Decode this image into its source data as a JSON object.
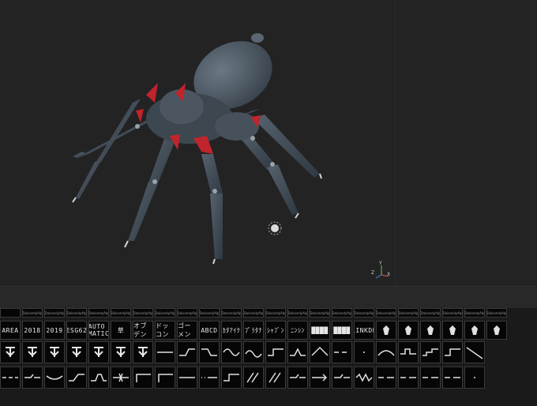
{
  "viewport": {
    "gizmo": {
      "x": "X",
      "y": "Y",
      "z": "Z"
    },
    "colors": {
      "background": "#232323",
      "model": "#4a5560",
      "accent": "#c0242c"
    }
  },
  "palette": {
    "caption_row": [
      "",
      "DaisandyAlp",
      "DaisandyAlp",
      "DaisandyAlp",
      "DaisandyAlp",
      "DaisandyAlp",
      "DaisandyAlp",
      "DaisandyAlp",
      "DaisandyAlp",
      "DaisandyAlp",
      "DaisandyAlp",
      "DaisandyAlp",
      "DaisandyAlp",
      "DaisandyAlp",
      "DaisandyAlp",
      "DaisandyAlp",
      "DaisandyAlp",
      "DaisandyAlp",
      "DaisandyAlp",
      "DaisandyAlp",
      "DaisandyAlp",
      "DaisandyAlp",
      "DaisandyAlp"
    ],
    "text_row": [
      "AREA",
      "2018",
      "2019",
      "ESG62",
      "AUTO MATIC",
      "草",
      "オブデン",
      "ドッコン",
      "ゴーメン",
      "ABCD",
      "ｶﾀｱｲｸ",
      "ﾌﾟﾗﾀﾅ",
      "ｼｬﾌﾞﾝ",
      "ﾆﾝｼﾝ",
      "████",
      "████",
      "LINKDE",
      "",
      "",
      "",
      "",
      "",
      ""
    ],
    "icon_row": [
      "glyph-a",
      "glyph-b",
      "glyph-c",
      "hash-glyph",
      "tuning-fork-glyph",
      "emblem-glyph",
      "skull-glyph",
      "flat-line",
      "step-up-line",
      "step-down-line",
      "wave-line",
      "sine-line",
      "step-line",
      "bump-line",
      "peak-line",
      "dash-line",
      "dot-line",
      "hill-line",
      "pulse-line",
      "double-step-line",
      "step-line",
      "diag-line"
    ],
    "line_row": [
      "dash-dash",
      "tick-line",
      "curve-line",
      "kink-line",
      "bump-line",
      "cross-line",
      "angle-line",
      "angle-line",
      "gradient-line",
      "dot-dash",
      "step-line",
      "slash-line",
      "slash-line",
      "tick-line",
      "arrow-line",
      "tick-line",
      "zigzag-line",
      "dash-line",
      "dash-line",
      "dash-line",
      "dash-line",
      "dot-line"
    ]
  }
}
